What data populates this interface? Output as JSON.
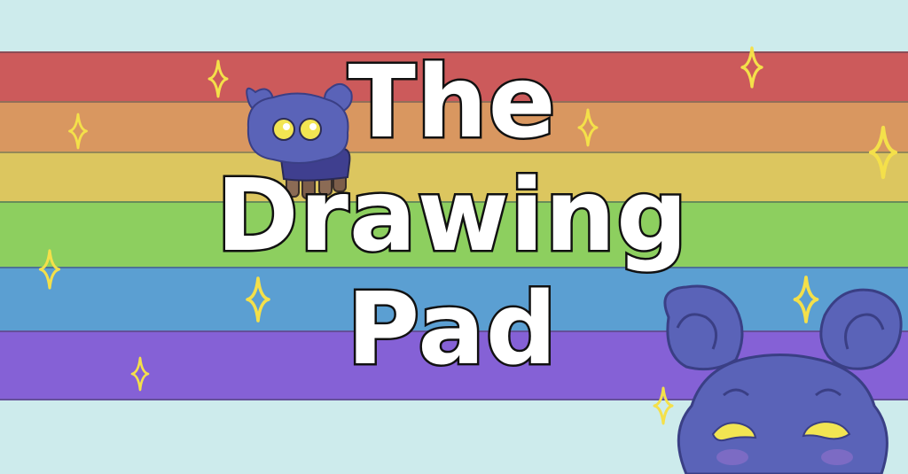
{
  "colors": {
    "background": "#cdebec",
    "stripes": [
      "#cc5a5b",
      "#d99760",
      "#dcc65f",
      "#8dcf5f",
      "#5b9fd2",
      "#8561d6"
    ],
    "sparkle": "#f4e04a",
    "creature": "#5a63b8",
    "creature_eyes": "#f2e552"
  },
  "title": {
    "line1": "The",
    "line2": "Drawing",
    "line3": "Pad"
  },
  "icons": {
    "sparkle": "four-point-star",
    "mascot_small": "blue-creature-with-sweater",
    "mascot_large": "blue-creature-peeking"
  }
}
